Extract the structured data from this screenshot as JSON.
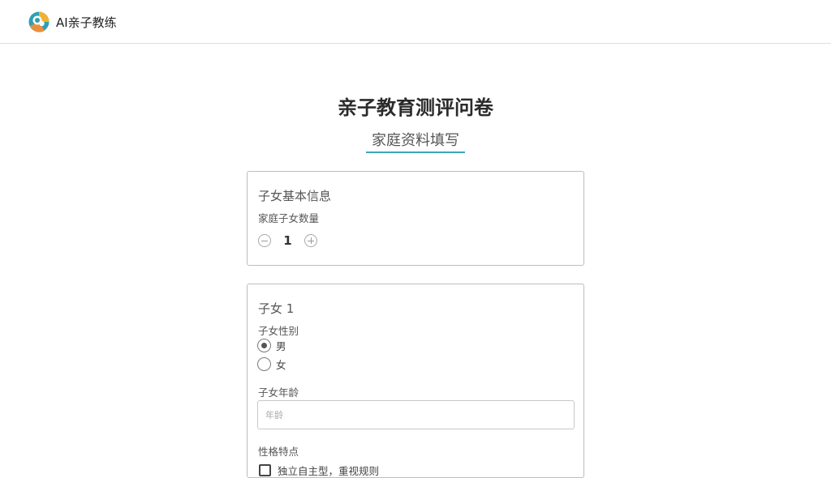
{
  "app": {
    "name": "AI亲子教练",
    "logo": "parent-child-logo-icon"
  },
  "page": {
    "title": "亲子教育测评问卷",
    "section": "家庭资料填写"
  },
  "basic_info": {
    "title": "子女基本信息",
    "children_count_label": "家庭子女数量",
    "children_count": "1",
    "decrement_icon": "minus-circle-icon",
    "increment_icon": "plus-circle-icon"
  },
  "child": {
    "title": "子女 1",
    "gender_label": "子女性别",
    "gender_options": [
      "男",
      "女"
    ],
    "gender_selected": "男",
    "age_label": "子女年龄",
    "age_placeholder": "年龄",
    "age_value": "",
    "personality_label": "性格特点",
    "personality_options": [
      "独立自主型，重视规则"
    ]
  },
  "colors": {
    "accent": "#3aa8b8",
    "border": "#bdbdbd",
    "text": "#333333"
  }
}
